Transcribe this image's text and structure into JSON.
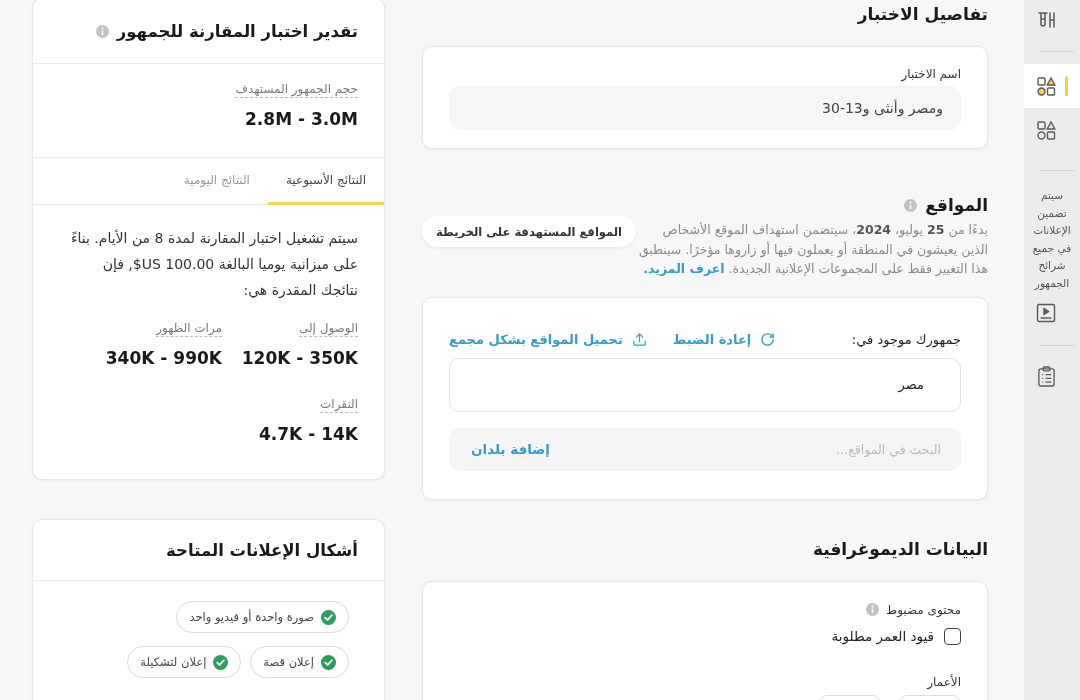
{
  "rail": {
    "items": [
      {
        "selected": false
      },
      {
        "selected": true
      },
      {
        "selected": false
      }
    ],
    "note": "سيتم تضمين الإعلانات في جميع شرائح الجمهور",
    "bottom_items": [
      {
        "selected": false
      },
      {
        "selected": false
      }
    ]
  },
  "test_details": {
    "title": "تفاصيل الاختبار",
    "name_label": "اسم الاختبار",
    "name_value": "ومصر وأنثى و13-30"
  },
  "locations": {
    "title": "المواقع",
    "notice": "بدءًا من **25** يوليو، **2024**، سيتضمن استهداف الموقع الأشخاص الذين يعيشون في المنطقة أو يعملون فيها أو زاروها مؤخرًا. سينطبق هذا التغيير فقط على المجموعات الإعلانية الجديدة.",
    "learn_more": "اعرف المزيد.",
    "map_button": "المواقع المستهدفة على الخريطة",
    "audience_label": "جمهورك موجود في:",
    "actions": [
      {
        "label": "إعادة الضبط"
      },
      {
        "label": "تحميل المواقع بشكل مجمع"
      }
    ],
    "selected_locations": [
      "مصر"
    ],
    "search": {
      "placeholder": "البحث في المواقع..."
    },
    "add_button": "إضافة بلدان"
  },
  "demographics": {
    "title": "البيانات الديموغرافية",
    "restricted_label": "محتوى مضبوط",
    "age_restriction": {
      "label": "قيود العمر مطلوبة",
      "checked": false
    },
    "ages_label": "الأعمار"
  },
  "estimate": {
    "title": "تقدير اختبار المقارنة للجمهور",
    "audience_size": {
      "label": "حجم الجمهور المستهدف",
      "value": "2.8M - 3.0M"
    },
    "tabs": [
      {
        "label": "النتائج الأسبوعية",
        "selected": true
      },
      {
        "label": "النتائج اليومية",
        "selected": false
      }
    ],
    "summary": "سيتم تشغيل اختبار المقارنة لمدة 8 من الأيام. بناءً على ميزانية يوميا البالغة 100.00 US$, فإن نتائجك المقدرة هي:",
    "metrics": [
      {
        "label": "الوصول إلى",
        "value": "120K - 350K"
      },
      {
        "label": "مرات الظهور",
        "value": "340K - 990K"
      },
      {
        "label": "النقرات",
        "value": "4.7K - 14K"
      }
    ]
  },
  "ad_formats": {
    "title": "أشكال الإعلانات المتاحة",
    "formats": [
      {
        "label": "صورة واحدة أو فيديو واحد",
        "available": true
      },
      {
        "label": "إعلان قصة",
        "available": true
      },
      {
        "label": "إعلان لتشكيلة",
        "available": true
      }
    ]
  }
}
